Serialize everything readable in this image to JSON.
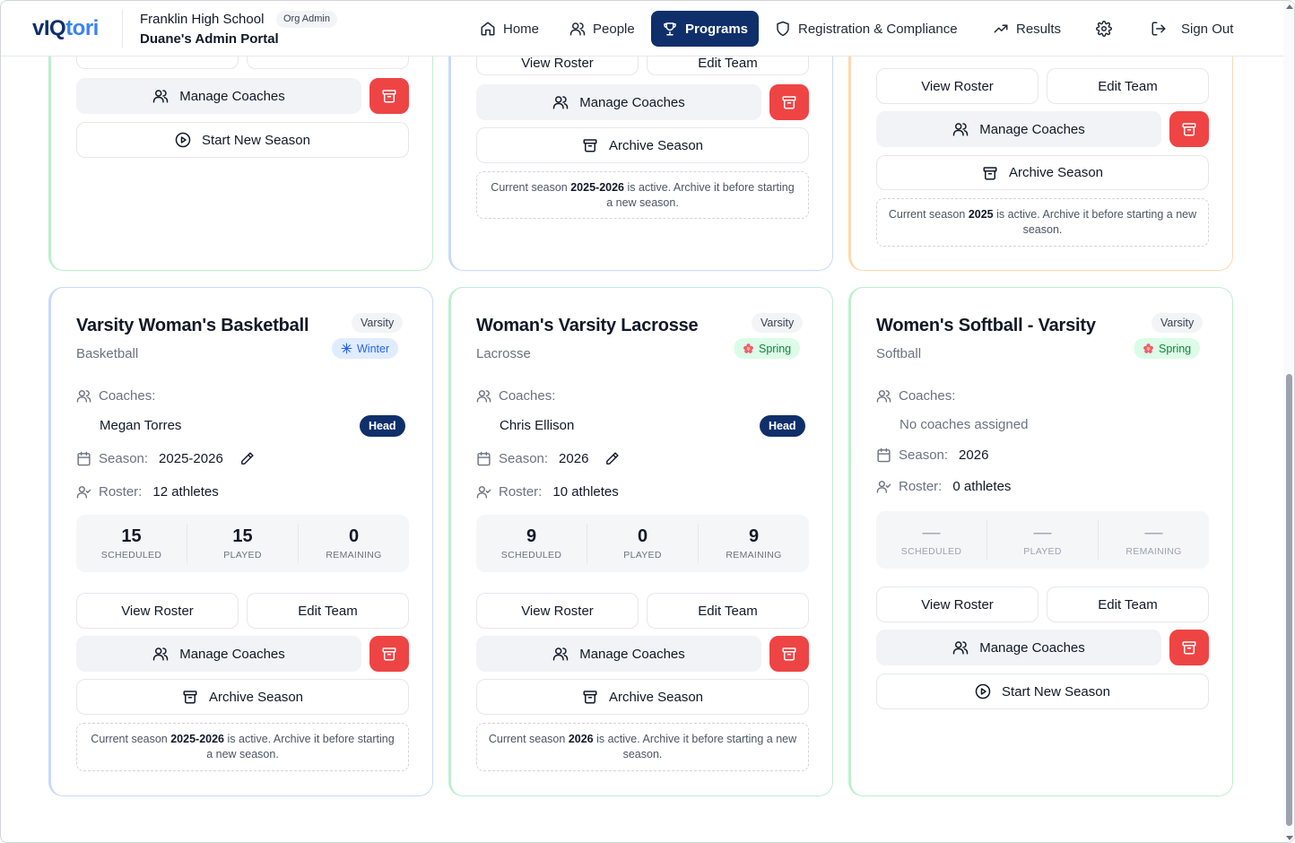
{
  "header": {
    "logo_part1": "vIQ",
    "logo_part2": "tori",
    "school": "Franklin High School",
    "role_badge": "Org Admin",
    "portal": "Duane's Admin Portal",
    "nav": {
      "home": "Home",
      "people": "People",
      "programs": "Programs",
      "registration": "Registration & Compliance",
      "results": "Results",
      "signout": "Sign Out"
    }
  },
  "top_cards": [
    {
      "manage_coaches": "Manage Coaches",
      "start_new_season": "Start New Season"
    },
    {
      "view_roster": "View Roster",
      "edit_team": "Edit Team",
      "manage_coaches": "Manage Coaches",
      "archive_season": "Archive Season",
      "notice_pre": "Current season ",
      "notice_season": "2025-2026",
      "notice_post": " is active. Archive it before starting a new season."
    },
    {
      "view_roster": "View Roster",
      "edit_team": "Edit Team",
      "manage_coaches": "Manage Coaches",
      "archive_season": "Archive Season",
      "notice_pre": "Current season ",
      "notice_season": "2025",
      "notice_post": " is active. Archive it before starting a new season."
    }
  ],
  "cards": [
    {
      "title": "Varsity Woman's Basketball",
      "sport": "Basketball",
      "level": "Varsity",
      "season_tag": "Winter",
      "coaches_label": "Coaches:",
      "coach_name": "Megan Torres",
      "coach_role": "Head",
      "season_label": "Season:",
      "season_value": "2025-2026",
      "roster_label": "Roster:",
      "roster_value": "12 athletes",
      "stats": {
        "scheduled": "15",
        "played": "15",
        "remaining": "0"
      },
      "stat_labels": {
        "scheduled": "SCHEDULED",
        "played": "PLAYED",
        "remaining": "REMAINING"
      },
      "view_roster": "View Roster",
      "edit_team": "Edit Team",
      "manage_coaches": "Manage Coaches",
      "archive_season": "Archive Season",
      "notice_pre": "Current season ",
      "notice_season": "2025-2026",
      "notice_post": " is active. Archive it before starting a new season."
    },
    {
      "title": "Woman's Varsity Lacrosse",
      "sport": "Lacrosse",
      "level": "Varsity",
      "season_tag": "Spring",
      "coaches_label": "Coaches:",
      "coach_name": "Chris Ellison",
      "coach_role": "Head",
      "season_label": "Season:",
      "season_value": "2026",
      "roster_label": "Roster:",
      "roster_value": "10 athletes",
      "stats": {
        "scheduled": "9",
        "played": "0",
        "remaining": "9"
      },
      "stat_labels": {
        "scheduled": "SCHEDULED",
        "played": "PLAYED",
        "remaining": "REMAINING"
      },
      "view_roster": "View Roster",
      "edit_team": "Edit Team",
      "manage_coaches": "Manage Coaches",
      "archive_season": "Archive Season",
      "notice_pre": "Current season ",
      "notice_season": "2026",
      "notice_post": " is active. Archive it before starting a new season."
    },
    {
      "title": "Women's Softball - Varsity",
      "sport": "Softball",
      "level": "Varsity",
      "season_tag": "Spring",
      "coaches_label": "Coaches:",
      "no_coaches": "No coaches assigned",
      "season_label": "Season:",
      "season_value": "2026",
      "roster_label": "Roster:",
      "roster_value": "0 athletes",
      "stats": {
        "scheduled": "—",
        "played": "—",
        "remaining": "—"
      },
      "stat_labels": {
        "scheduled": "SCHEDULED",
        "played": "PLAYED",
        "remaining": "REMAINING"
      },
      "view_roster": "View Roster",
      "edit_team": "Edit Team",
      "manage_coaches": "Manage Coaches",
      "start_new_season": "Start New Season"
    }
  ],
  "colors": {
    "brand_navy": "#0f2f6b",
    "danger": "#ef4444",
    "winter": "#2563eb",
    "spring": "#15803d"
  }
}
